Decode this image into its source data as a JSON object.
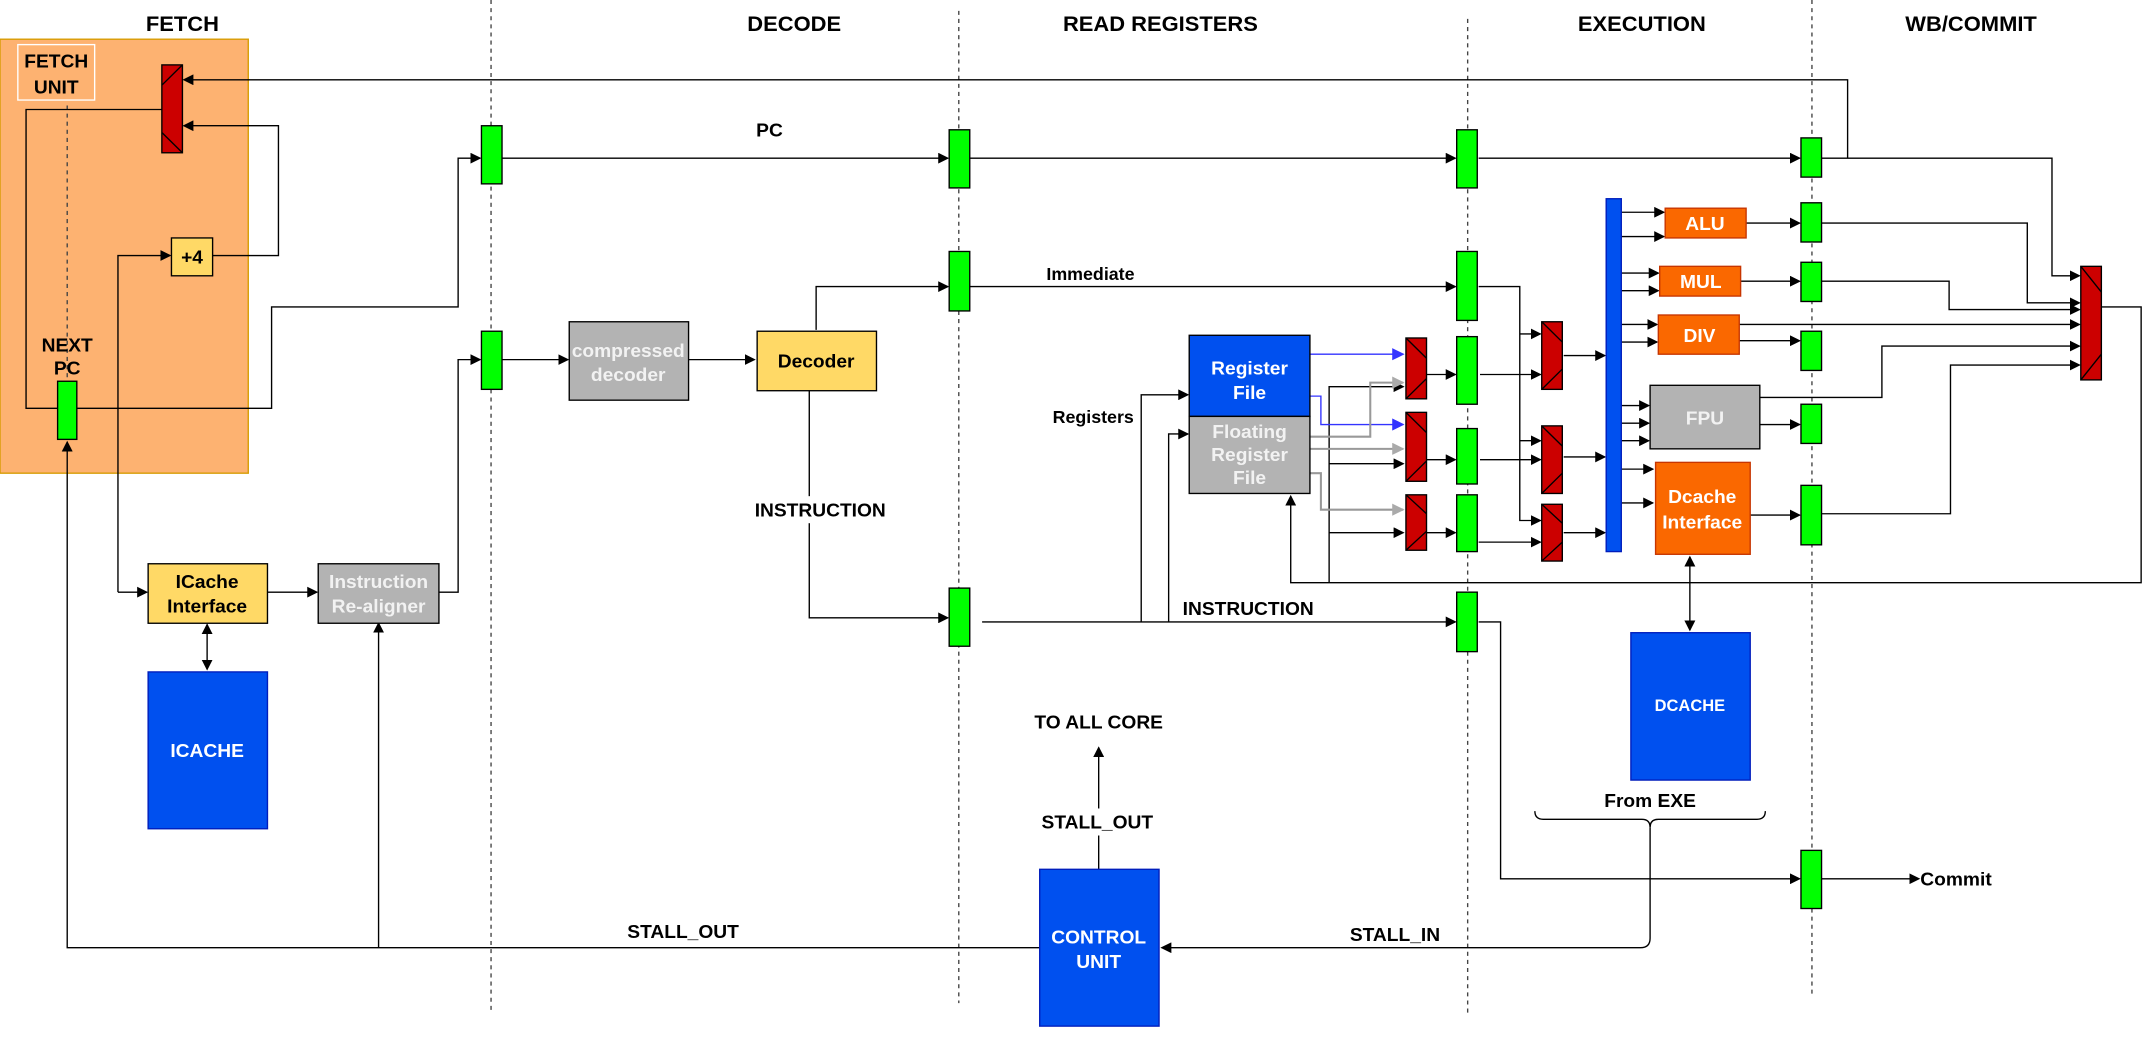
{
  "stages": [
    "FETCH",
    "DECODE",
    "READ REGISTERS",
    "EXECUTION",
    "WB/COMMIT"
  ],
  "fetch_unit": {
    "title_line1": "FETCH",
    "title_line2": "UNIT",
    "next_pc_line1": "NEXT",
    "next_pc_line2": "PC",
    "adder": "+4"
  },
  "blocks": {
    "icache_interface_line1": "ICache",
    "icache_interface_line2": "Interface",
    "icache": "ICACHE",
    "realigner_line1": "Instruction",
    "realigner_line2": "Re-aligner",
    "compressed_decoder_line1": "compressed",
    "compressed_decoder_line2": "decoder",
    "decoder": "Decoder",
    "register_file_line1": "Register",
    "register_file_line2": "File",
    "fp_register_file_line1": "Floating",
    "fp_register_file_line2": "Register",
    "fp_register_file_line3": "File",
    "alu": "ALU",
    "mul": "MUL",
    "div": "DIV",
    "fpu": "FPU",
    "dcache_interface_line1": "Dcache",
    "dcache_interface_line2": "Interface",
    "dcache": "DCACHE",
    "control_unit_line1": "CONTROL",
    "control_unit_line2": "UNIT"
  },
  "signals": {
    "pc": "PC",
    "immediate": "Immediate",
    "registers": "Registers",
    "instruction_decode": "INSTRUCTION",
    "instruction_read": "INSTRUCTION",
    "to_all_core": "TO ALL CORE",
    "stall_out_up": "STALL_OUT",
    "stall_out_left": "STALL_OUT",
    "stall_in": "STALL_IN",
    "from_exe": "From EXE",
    "commit": "Commit"
  },
  "colors": {
    "fetch_unit_bg": "#fdb271",
    "pipeline_register": "#00ff00",
    "mux": "#cc0000",
    "blue_block": "#0050ef",
    "yellow_block": "#ffd966",
    "gray_block": "#b3b3b3",
    "orange_block": "#fa6800"
  }
}
